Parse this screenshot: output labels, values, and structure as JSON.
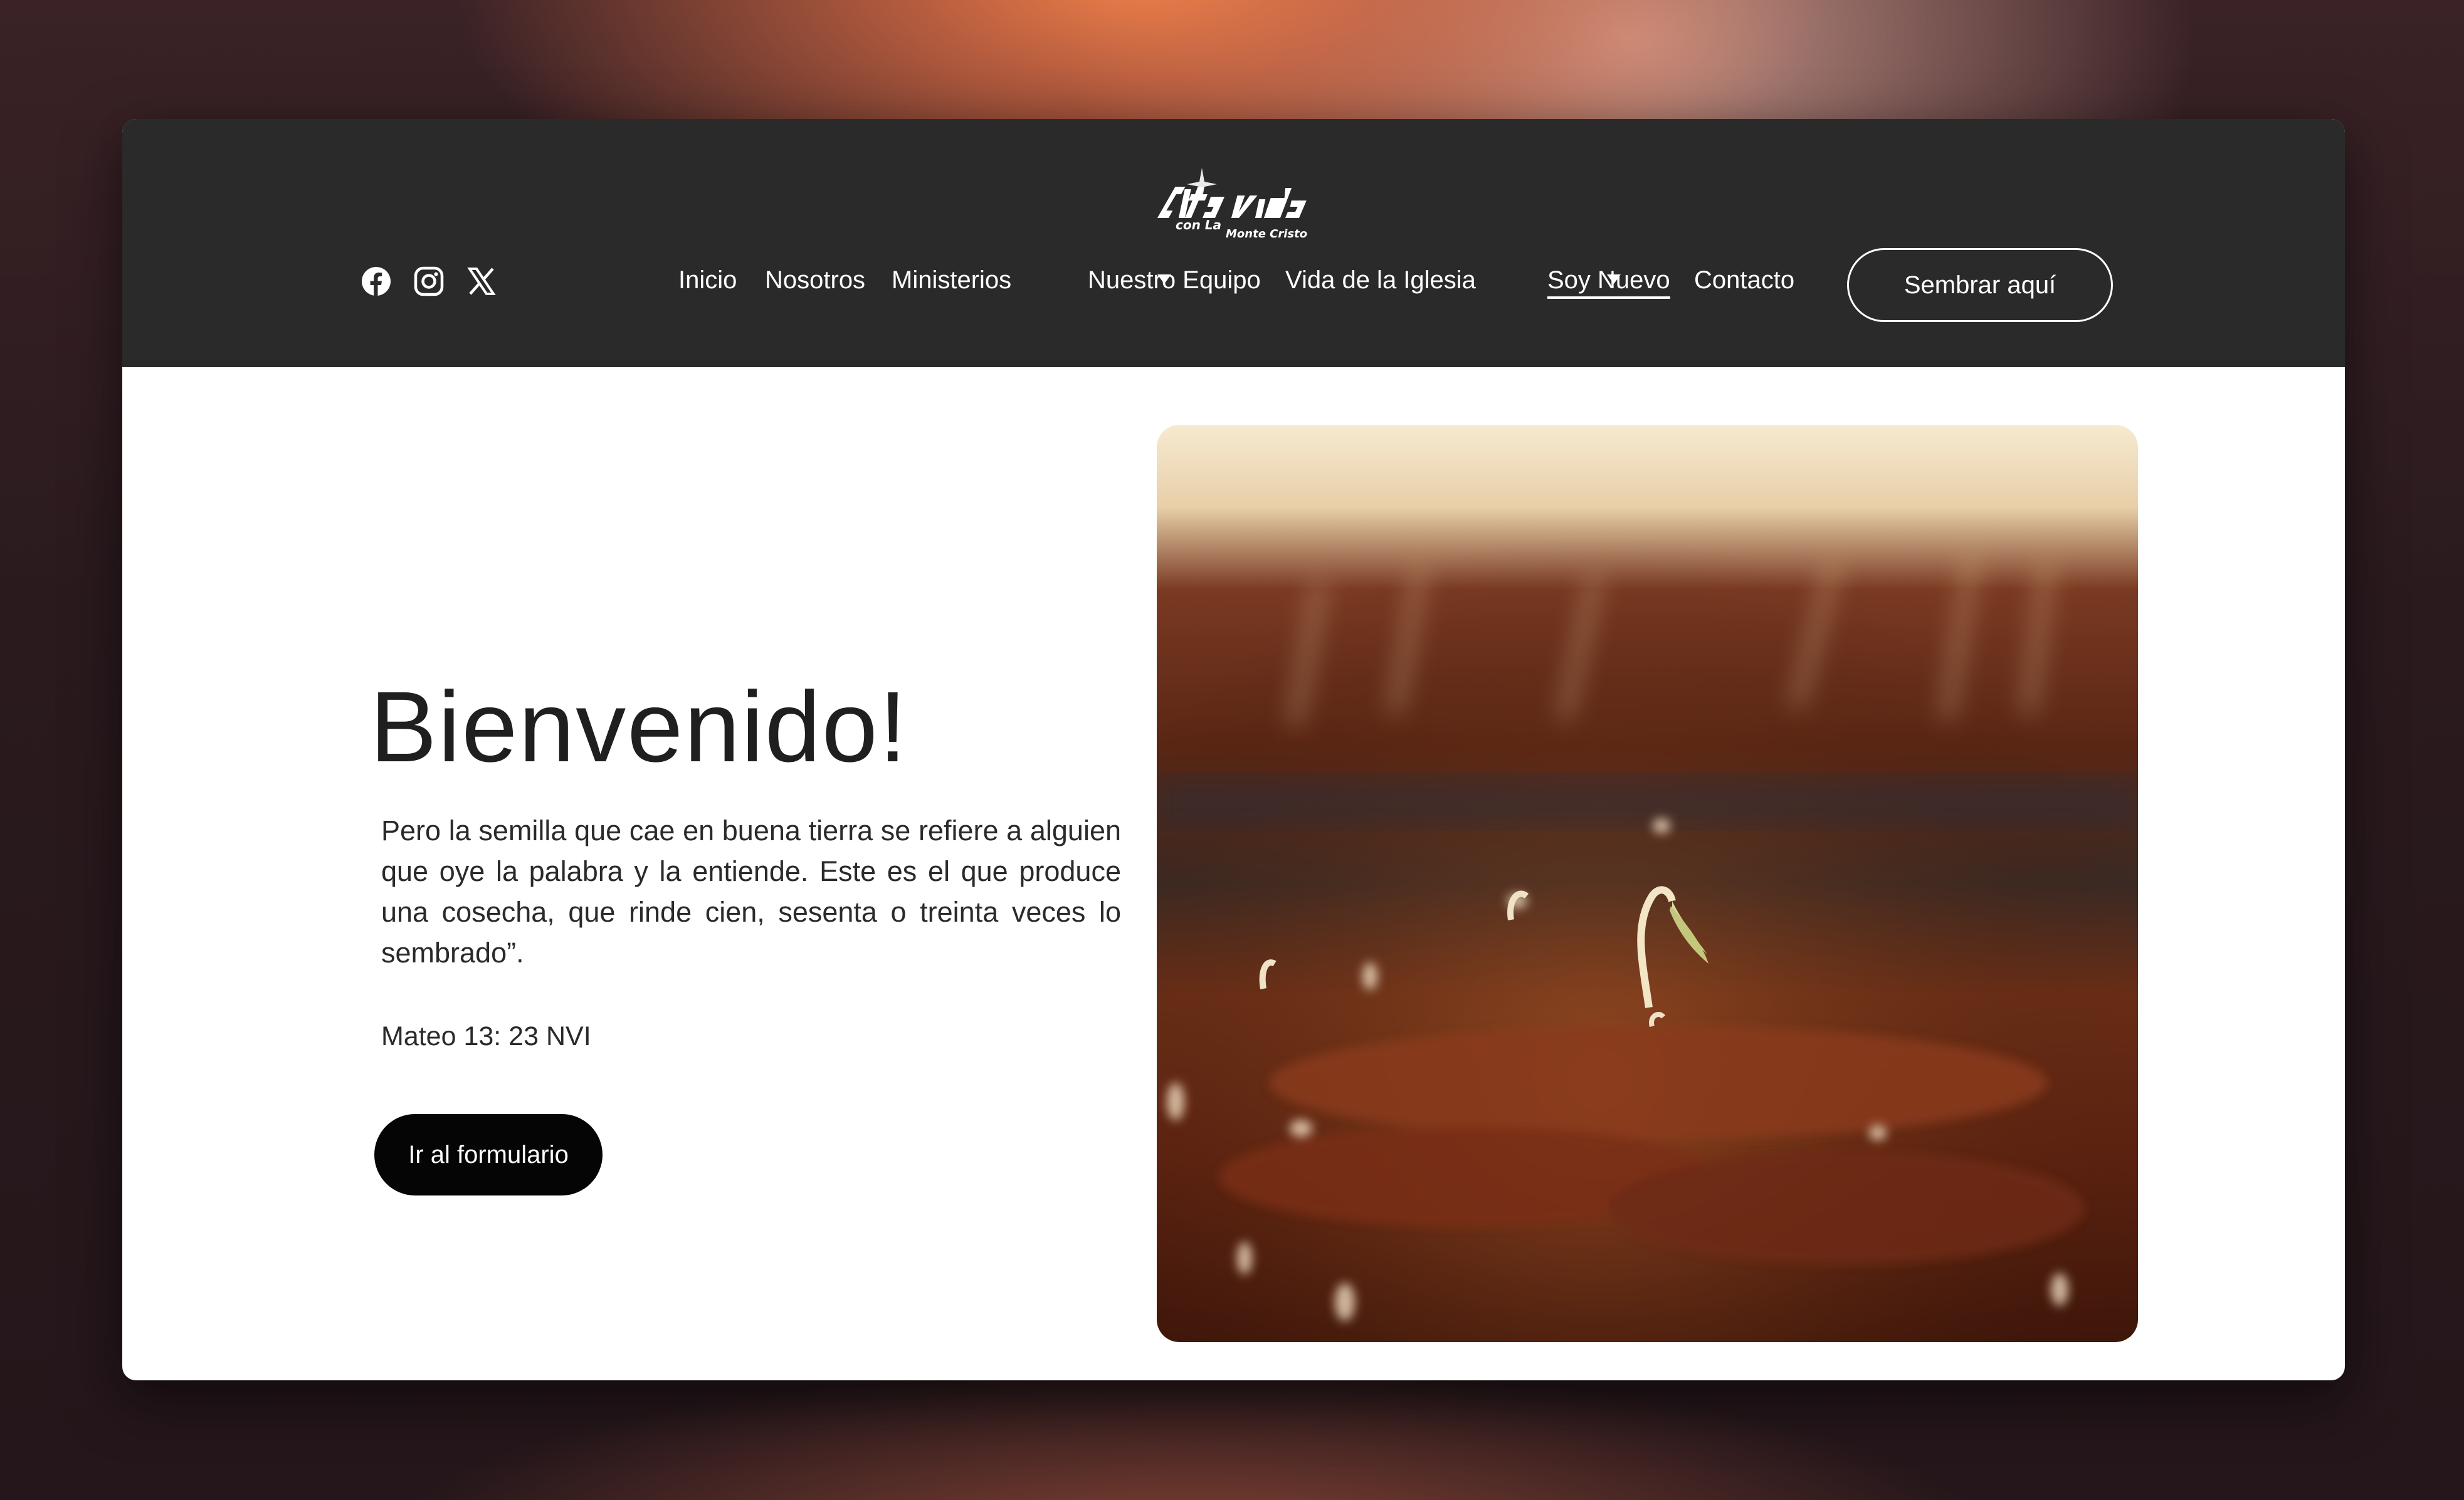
{
  "site": {
    "logo_alt": "Cita con la Vida Monte Cristo"
  },
  "social": [
    "facebook-icon",
    "instagram-icon",
    "x-twitter-icon"
  ],
  "nav": {
    "items": [
      {
        "label": "Inicio",
        "dropdown": false,
        "active": false
      },
      {
        "label": "Nosotros",
        "dropdown": false,
        "active": false
      },
      {
        "label": "Ministerios",
        "dropdown": true,
        "active": false
      },
      {
        "label": "Nuestro Equipo",
        "dropdown": false,
        "active": false
      },
      {
        "label": "Vida de la Iglesia",
        "dropdown": true,
        "active": false
      },
      {
        "label": "Soy Nuevo",
        "dropdown": false,
        "active": true
      },
      {
        "label": "Contacto",
        "dropdown": false,
        "active": false
      }
    ],
    "cta_label": "Sembrar aquí"
  },
  "hero": {
    "title": "Bienvenido!",
    "quote": "Pero la semilla que cae en buena tierra se refiere a alguien que oye la palabra y la entiende. Este es el que produce una cosecha, que rinde cien, sesenta o treinta veces lo sembrado”.",
    "reference": "Mateo 13: 23 NVI",
    "button_label": "Ir al formulario"
  },
  "colors": {
    "header_bg": "#2a2a2a",
    "page_bg": "#ffffff",
    "button_dark": "#050505",
    "text": "#1f1f1f"
  }
}
